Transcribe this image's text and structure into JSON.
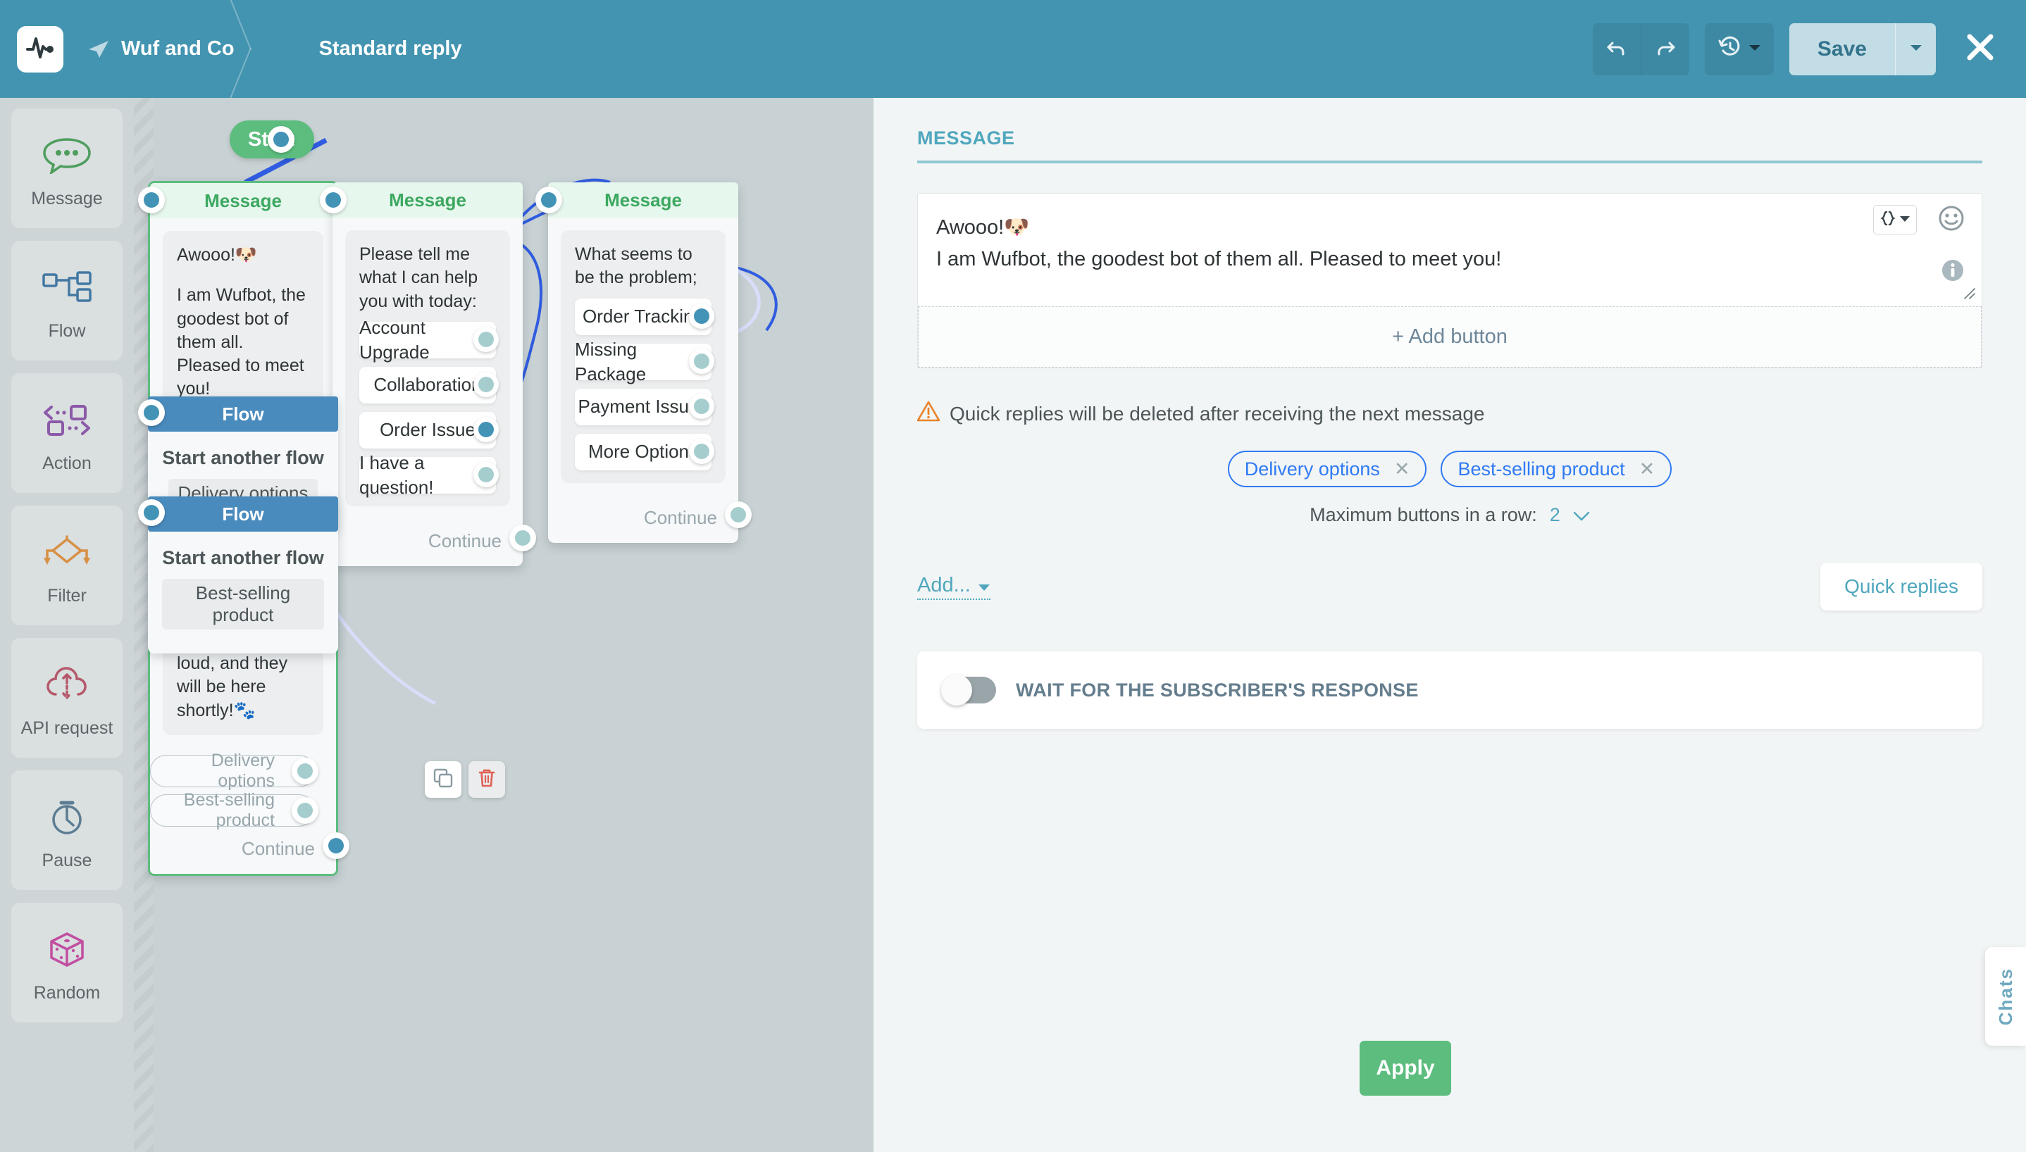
{
  "topbar": {
    "logo_icon": "pulse-logo-icon",
    "send_icon": "paper-plane-icon",
    "account_name": "Wuf and Co",
    "flow_name": "Standard reply",
    "undo_icon": "undo-icon",
    "redo_icon": "redo-icon",
    "history_icon": "history-clock-icon",
    "save_label": "Save",
    "save_caret_icon": "chevron-down-icon",
    "close_icon": "close-x-icon"
  },
  "left_rail": {
    "items": [
      {
        "label": "Message",
        "icon": "chat-bubble-icon",
        "color": "#4e9e5e"
      },
      {
        "label": "Flow",
        "icon": "flow-tree-icon",
        "color": "#4278a3"
      },
      {
        "label": "Action",
        "icon": "action-arrows-icon",
        "color": "#8c5aa8"
      },
      {
        "label": "Filter",
        "icon": "filter-diamond-icon",
        "color": "#d79044"
      },
      {
        "label": "API request",
        "icon": "cloud-api-icon",
        "color": "#b4596b"
      },
      {
        "label": "Pause",
        "icon": "stopwatch-icon",
        "color": "#5b7d93"
      },
      {
        "label": "Random",
        "icon": "dice-cube-icon",
        "color": "#c14fa0"
      }
    ]
  },
  "canvas": {
    "start": {
      "label": "Start"
    },
    "node_actions": {
      "copy_icon": "copy-icon",
      "delete_icon": "trash-icon"
    },
    "nodes": [
      {
        "id": "msg1",
        "type": "message",
        "header": "Message",
        "selected": true,
        "paragraphs": [
          "Awooo!🐶",
          "I am Wufbot, the goodest bot of them all. Pleased to meet you!",
          "I am here to help you while my customer service hoomans are out getting treats for me. But if you need to talk to a human, I'll start barking really loud, and they will be here shortly!🐾"
        ],
        "quick_replies": [
          "Delivery options",
          "Best-selling product"
        ],
        "continue_label": "Continue"
      },
      {
        "id": "msg2",
        "type": "message",
        "header": "Message",
        "prompt": "Please tell me what I can help you with today:",
        "choices": [
          "Account Upgrade",
          "Collaboration",
          "Order Issue",
          "I have a question!"
        ],
        "active_choice": "Order Issue",
        "continue_label": "Continue"
      },
      {
        "id": "msg3",
        "type": "message",
        "header": "Message",
        "prompt": "What seems to be the problem;",
        "choices": [
          "Order Tracking",
          "Missing Package",
          "Payment Issues",
          "More Options"
        ],
        "active_choice": "Order Tracking",
        "continue_label": "Continue"
      },
      {
        "id": "flow1",
        "type": "flow",
        "header": "Flow",
        "title": "Start another flow",
        "chip": "Delivery options"
      },
      {
        "id": "flow2",
        "type": "flow",
        "header": "Flow",
        "title": "Start another flow",
        "chip": "Best-selling product"
      }
    ]
  },
  "panel": {
    "section_title": "MESSAGE",
    "message_value": "Awooo!🐶\nI am Wufbot, the goodest bot of them all. Pleased to meet you!",
    "brace_icon": "merge-field-braces-icon",
    "emoji_icon": "emoji-smiley-icon",
    "info_icon": "info-circle-icon",
    "resize_icon": "resize-grip-icon",
    "add_button_label": "+ Add button",
    "warning_icon": "warning-triangle-icon",
    "warning_text": "Quick replies will be deleted after receiving the next message",
    "quick_reply_chips": [
      {
        "label": "Delivery options",
        "remove_icon": "x-icon"
      },
      {
        "label": "Best-selling product",
        "remove_icon": "x-icon"
      }
    ],
    "max_buttons_label": "Maximum buttons in a row:",
    "max_buttons_value": "2",
    "max_buttons_caret": "chevron-down-icon",
    "add_dropdown_label": "Add...",
    "add_dropdown_caret": "caret-down-icon",
    "quick_replies_btn_label": "Quick replies",
    "wait_toggle_label": "WAIT FOR THE SUBSCRIBER'S RESPONSE",
    "wait_toggle_state": "off",
    "apply_label": "Apply"
  },
  "chats_tab": {
    "label": "Chats"
  },
  "colors": {
    "header_blue": "#4394b0",
    "accent_teal": "#4fa7bd",
    "green": "#5cbd7e",
    "node_blue": "#4a8bbd",
    "edge_blue": "#2f5ce0",
    "canvas_bg": "#c8d1d3",
    "panel_bg": "#f2f5f5",
    "chip_blue": "#2f7af5",
    "warning_orange": "#e8832a"
  }
}
